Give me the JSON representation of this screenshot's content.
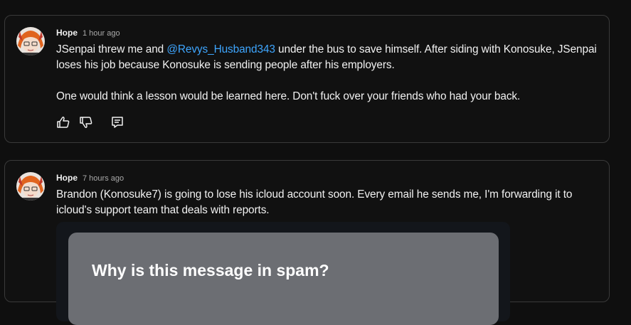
{
  "comments": [
    {
      "author": "Hope",
      "time": "1 hour ago",
      "line1_before": "JSenpai threw me and ",
      "mention": "@Revys_Husband343",
      "line1_after": " under the bus to save himself. After siding with Konosuke, JSenpai loses his job because Konosuke is sending people after his employers.",
      "paragraph2": "One would think a lesson would be learned here. Don't fuck over your friends who had your back.",
      "actions": {
        "like_icon": "thumbs-up-icon",
        "dislike_icon": "thumbs-down-icon",
        "reply_icon": "reply-icon"
      }
    },
    {
      "author": "Hope",
      "time": "7 hours ago",
      "text": "Brandon (Konosuke7) is going to lose his icloud account soon. Every email he sends me, I'm forwarding it to icloud's support team that deals with reports.",
      "embed_title": "Why is this message in spam?"
    }
  ],
  "colors": {
    "background": "#0f0f0f",
    "mention": "#3ea6ff",
    "border": "#3a3a3a"
  }
}
